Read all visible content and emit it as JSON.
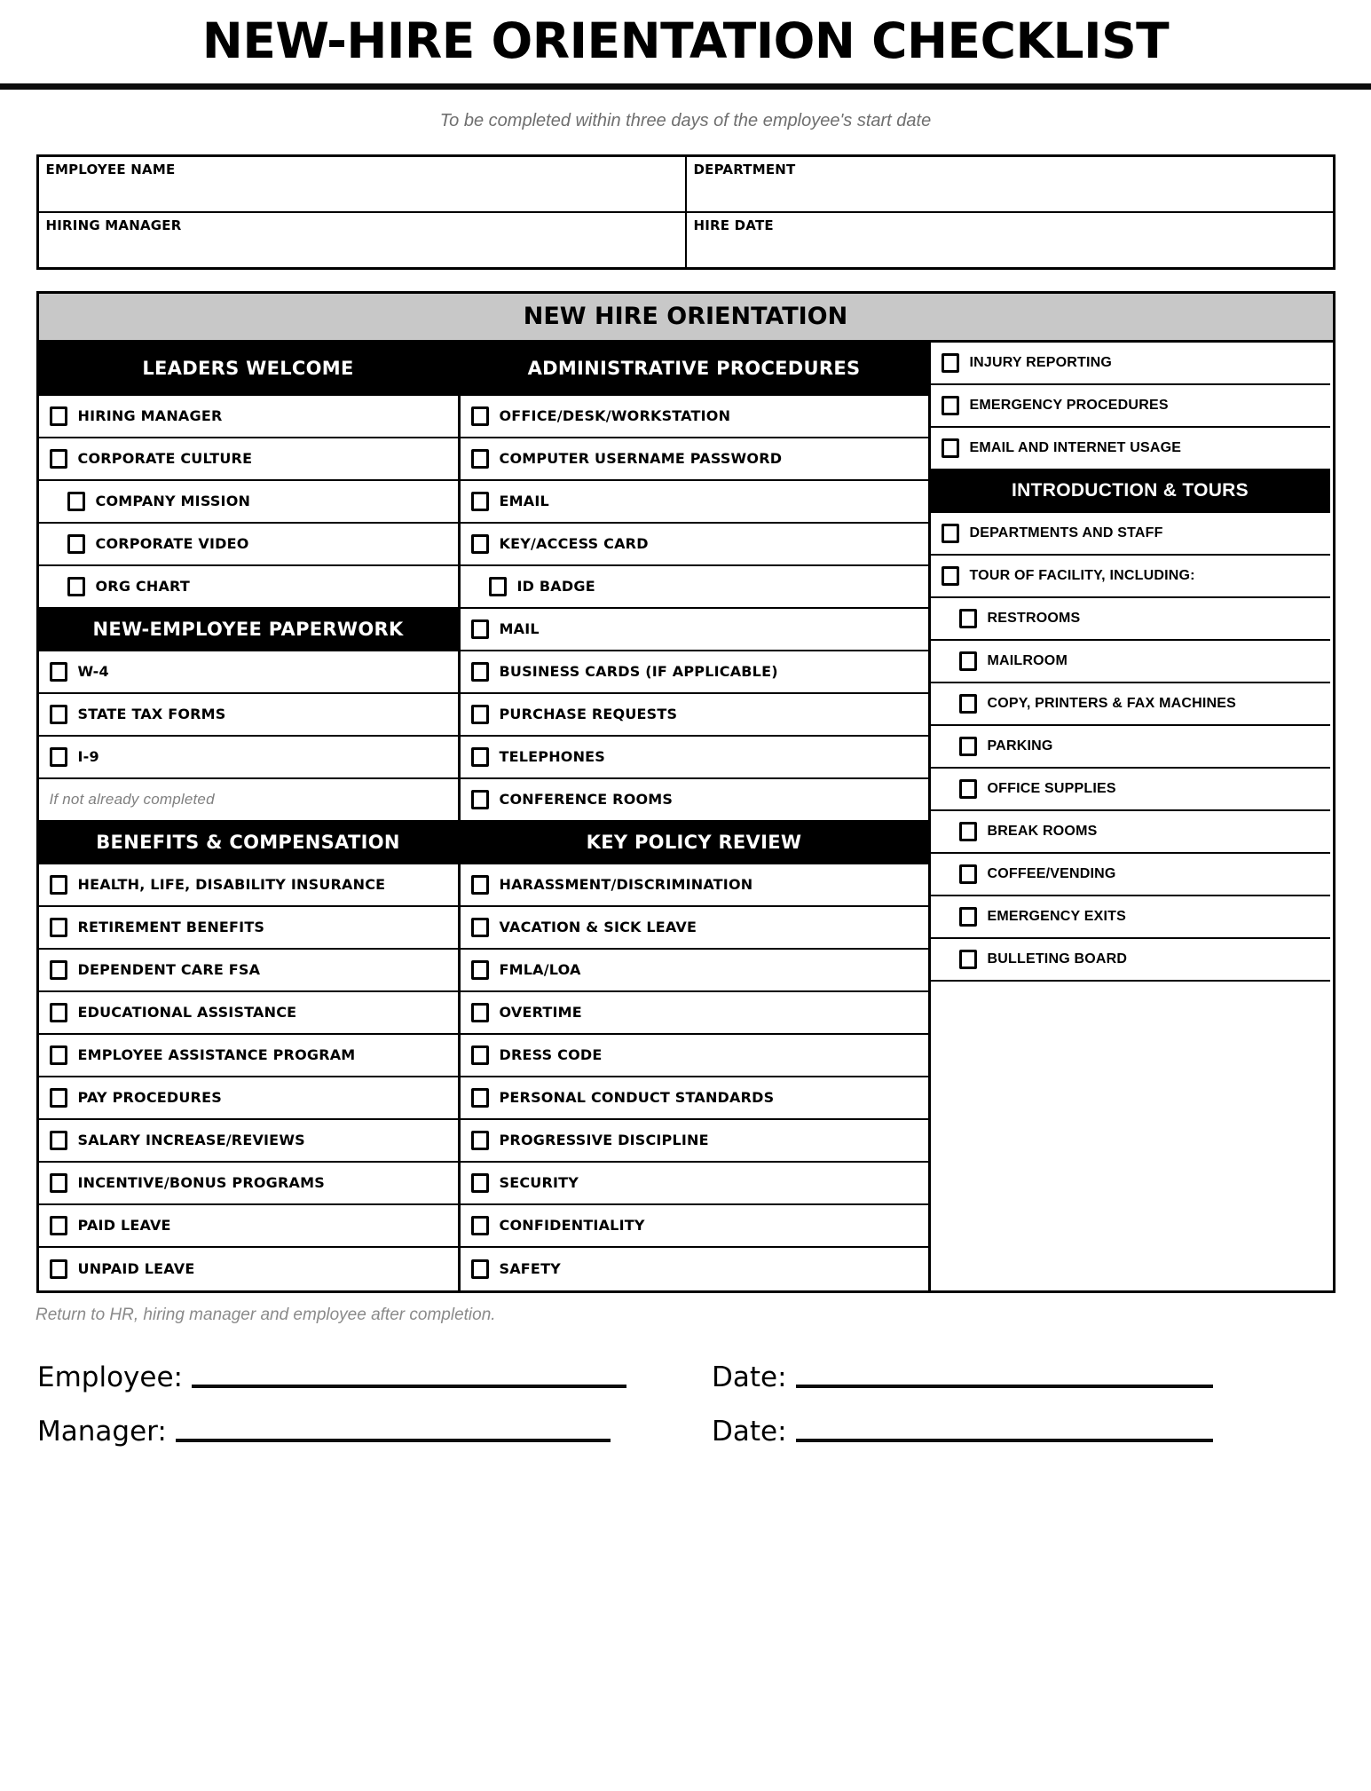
{
  "document": {
    "title": "NEW-HIRE ORIENTATION CHECKLIST",
    "subtitle": "To be completed within three days of the employee's start date",
    "return_note": "Return to HR, hiring manager and employee after completion."
  },
  "info_fields": [
    {
      "label": "EMPLOYEE NAME",
      "value": ""
    },
    {
      "label": "DEPARTMENT",
      "value": ""
    },
    {
      "label": "HIRING MANAGER",
      "value": ""
    },
    {
      "label": "HIRE DATE",
      "value": ""
    }
  ],
  "checklist": {
    "band_title": "NEW HIRE ORIENTATION",
    "column_1": [
      {
        "type": "header",
        "label": "LEADERS WELCOME"
      },
      {
        "type": "item",
        "label": "HIRING MANAGER",
        "indent": false
      },
      {
        "type": "item",
        "label": "CORPORATE CULTURE",
        "indent": false
      },
      {
        "type": "item",
        "label": "COMPANY MISSION",
        "indent": true
      },
      {
        "type": "item",
        "label": "CORPORATE VIDEO",
        "indent": true
      },
      {
        "type": "item",
        "label": "ORG CHART",
        "indent": true
      },
      {
        "type": "header",
        "label": "NEW-EMPLOYEE PAPERWORK"
      },
      {
        "type": "item",
        "label": "W-4",
        "indent": false
      },
      {
        "type": "item",
        "label": "STATE TAX FORMS",
        "indent": false
      },
      {
        "type": "item",
        "label": "I-9",
        "indent": false
      },
      {
        "type": "note",
        "label": "If not already completed"
      },
      {
        "type": "header",
        "label": "BENEFITS & COMPENSATION"
      },
      {
        "type": "item",
        "label": "HEALTH, LIFE, DISABILITY INSURANCE",
        "indent": false
      },
      {
        "type": "item",
        "label": "RETIREMENT BENEFITS",
        "indent": false
      },
      {
        "type": "item",
        "label": "DEPENDENT CARE FSA",
        "indent": false
      },
      {
        "type": "item",
        "label": "EDUCATIONAL ASSISTANCE",
        "indent": false
      },
      {
        "type": "item",
        "label": "EMPLOYEE ASSISTANCE PROGRAM",
        "indent": false
      },
      {
        "type": "item",
        "label": "PAY PROCEDURES",
        "indent": false
      },
      {
        "type": "item",
        "label": "SALARY INCREASE/REVIEWS",
        "indent": false
      },
      {
        "type": "item",
        "label": "INCENTIVE/BONUS PROGRAMS",
        "indent": false
      },
      {
        "type": "item",
        "label": "PAID LEAVE",
        "indent": false
      },
      {
        "type": "item",
        "label": "UNPAID LEAVE",
        "indent": false
      }
    ],
    "column_2": [
      {
        "type": "header",
        "label": "ADMINISTRATIVE PROCEDURES"
      },
      {
        "type": "item",
        "label": "OFFICE/DESK/WORKSTATION",
        "indent": false
      },
      {
        "type": "item",
        "label": "COMPUTER USERNAME PASSWORD",
        "indent": false
      },
      {
        "type": "item",
        "label": "EMAIL",
        "indent": false
      },
      {
        "type": "item",
        "label": "KEY/ACCESS CARD",
        "indent": false
      },
      {
        "type": "item",
        "label": "ID BADGE",
        "indent": true
      },
      {
        "type": "item",
        "label": "MAIL",
        "indent": false
      },
      {
        "type": "item",
        "label": "BUSINESS CARDS (IF APPLICABLE)",
        "indent": false
      },
      {
        "type": "item",
        "label": "PURCHASE REQUESTS",
        "indent": false
      },
      {
        "type": "item",
        "label": "TELEPHONES",
        "indent": false
      },
      {
        "type": "item",
        "label": "CONFERENCE ROOMS",
        "indent": false
      },
      {
        "type": "header",
        "label": "KEY POLICY REVIEW"
      },
      {
        "type": "item",
        "label": "HARASSMENT/DISCRIMINATION",
        "indent": false
      },
      {
        "type": "item",
        "label": "VACATION & SICK LEAVE",
        "indent": false
      },
      {
        "type": "item",
        "label": "FMLA/LOA",
        "indent": false
      },
      {
        "type": "item",
        "label": "OVERTIME",
        "indent": false
      },
      {
        "type": "item",
        "label": "DRESS CODE",
        "indent": false
      },
      {
        "type": "item",
        "label": "PERSONAL CONDUCT STANDARDS",
        "indent": false
      },
      {
        "type": "item",
        "label": "PROGRESSIVE DISCIPLINE",
        "indent": false
      },
      {
        "type": "item",
        "label": "SECURITY",
        "indent": false
      },
      {
        "type": "item",
        "label": "CONFIDENTIALITY",
        "indent": false
      },
      {
        "type": "item",
        "label": "SAFETY",
        "indent": false
      }
    ],
    "column_3": [
      {
        "type": "item",
        "label": "INJURY REPORTING",
        "indent": false
      },
      {
        "type": "item",
        "label": "EMERGENCY PROCEDURES",
        "indent": false
      },
      {
        "type": "item",
        "label": "EMAIL AND INTERNET USAGE",
        "indent": false
      },
      {
        "type": "header",
        "label": "INTRODUCTION & TOURS"
      },
      {
        "type": "item",
        "label": "DEPARTMENTS AND STAFF",
        "indent": false
      },
      {
        "type": "item",
        "label": "TOUR OF FACILITY, INCLUDING:",
        "indent": false
      },
      {
        "type": "item",
        "label": "RESTROOMS",
        "indent": true
      },
      {
        "type": "item",
        "label": "MAILROOM",
        "indent": true
      },
      {
        "type": "item",
        "label": "COPY, PRINTERS & FAX MACHINES",
        "indent": true
      },
      {
        "type": "item",
        "label": "PARKING",
        "indent": true
      },
      {
        "type": "item",
        "label": "OFFICE SUPPLIES",
        "indent": true
      },
      {
        "type": "item",
        "label": "BREAK ROOMS",
        "indent": true
      },
      {
        "type": "item",
        "label": "COFFEE/VENDING",
        "indent": true
      },
      {
        "type": "item",
        "label": "EMERGENCY EXITS",
        "indent": true
      },
      {
        "type": "item",
        "label": "BULLETING BOARD",
        "indent": true
      },
      {
        "type": "blank",
        "label": ""
      },
      {
        "type": "blank",
        "label": ""
      },
      {
        "type": "blank",
        "label": ""
      },
      {
        "type": "blank",
        "label": ""
      },
      {
        "type": "blank",
        "label": ""
      },
      {
        "type": "blank",
        "label": ""
      },
      {
        "type": "blank",
        "label": ""
      }
    ]
  },
  "signatures": [
    {
      "name_label": "Employee:",
      "date_label": "Date:"
    },
    {
      "name_label": "Manager:",
      "date_label": "Date:"
    }
  ],
  "colors": {
    "band_background": "#c8c8c8",
    "header_background": "#000000",
    "rule": "#0d0d0d",
    "muted_text": "#808080"
  }
}
